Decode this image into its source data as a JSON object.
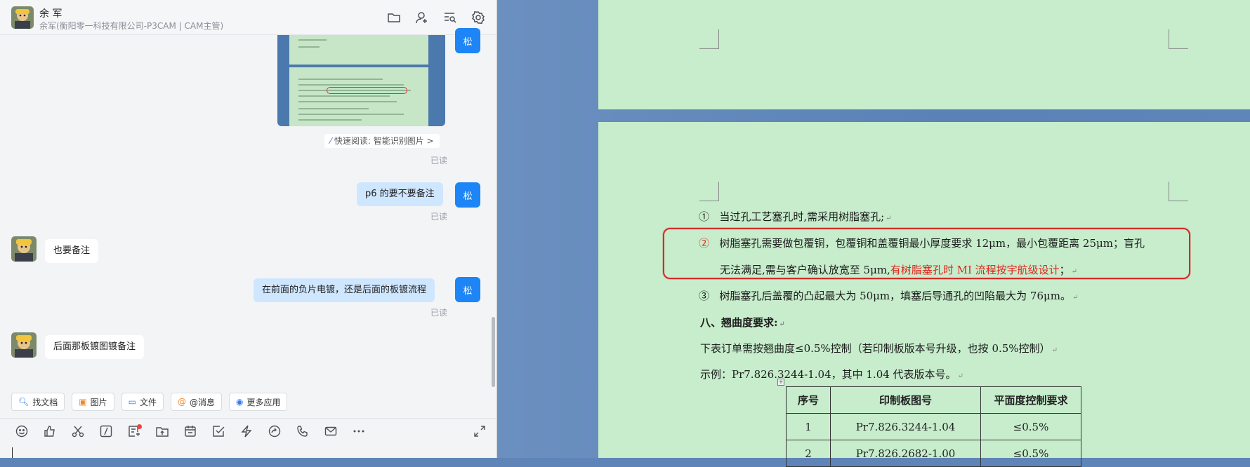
{
  "chat": {
    "header": {
      "name": "余 军",
      "subtitle": "余军(衡阳零一科技有限公司-P3CAM | CAM主管)",
      "icons": [
        "folder-icon",
        "add-user-icon",
        "search-history-icon",
        "settings-icon"
      ]
    },
    "messages": {
      "me_avatar_label": "松",
      "quick_read": "快速阅读: 智能识别图片 >",
      "read_label": "已读",
      "msg_p6": "p6 的要不要备注",
      "reply_1": "也要备注",
      "msg_plating": "在前面的负片电镀，还是后面的板镀流程",
      "reply_2": "后面那板镀图镀备注"
    },
    "toolbar": {
      "find_doc": "找文档",
      "image": "图片",
      "file": "文件",
      "mention": "@消息",
      "more_apps": "更多应用"
    },
    "input_icons": [
      "emoji-icon",
      "thumbs-up-icon",
      "scissors-icon",
      "slash-icon",
      "form-icon",
      "upload-icon",
      "calendar-icon",
      "checkbox-icon",
      "lightning-icon",
      "screen-share-icon",
      "phone-icon",
      "mail-icon",
      "more-icon"
    ]
  },
  "document": {
    "item1_num": "①",
    "item1": "当过孔工艺塞孔时,需采用树脂塞孔;",
    "item2_num": "②",
    "item2_line1": "树脂塞孔需要做包覆铜，包覆铜和盖覆铜最小厚度要求 12μm，最小包覆距离 25μm；盲孔",
    "item2_line2a": "无法满足,需与客户确认放宽至 5μm,",
    "item2_line2b": "有树脂塞孔时 MI 流程按宇航级设计",
    "item2_line2c": "；",
    "item3_num": "③",
    "item3": "树脂塞孔后盖覆的凸起最大为 50μm，填塞后导通孔的凹陷最大为 76μm。",
    "section8": "八、翘曲度要求:",
    "para1": "下表订单需按翘曲度≤0.5%控制（若印制板版本号升级，也按 0.5%控制）",
    "para2": "示例：Pr7.826.3244-1.04，其中 1.04 代表版本号。",
    "return_mark": "↵",
    "table": {
      "headers": [
        "序号",
        "印制板图号",
        "平面度控制要求"
      ],
      "rows": [
        [
          "1",
          "Pr7.826.3244-1.04",
          "≤0.5%"
        ],
        [
          "2",
          "Pr7.826.2682-1.00",
          "≤0.5%"
        ]
      ]
    }
  },
  "colors": {
    "page_green": "#c7edcc",
    "my_bubble": "#cfe6ff",
    "accent_blue": "#1d85f5",
    "highlight_red": "#d42a2a"
  }
}
